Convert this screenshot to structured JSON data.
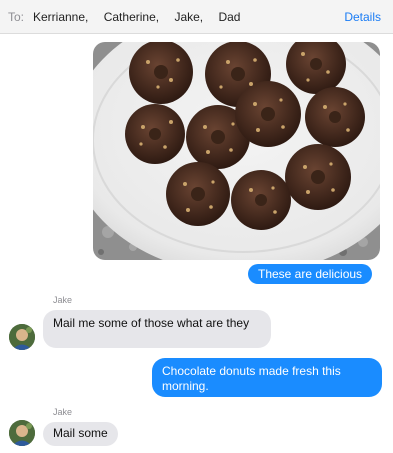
{
  "header": {
    "to_label": "To:",
    "recipients": [
      "Kerrianne,",
      "Catherine,",
      "Jake,",
      "Dad"
    ],
    "details_label": "Details"
  },
  "messages": [
    {
      "from": "me",
      "type": "image",
      "description": "photo-chocolate-donuts"
    },
    {
      "from": "me",
      "text": "These are delicious"
    },
    {
      "from": "Jake",
      "sender_label": "Jake",
      "text": "Mail me some of those what are they"
    },
    {
      "from": "me",
      "text": "Chocolate donuts made fresh this morning."
    },
    {
      "from": "Jake",
      "sender_label": "Jake",
      "text": "Mail some"
    }
  ],
  "colors": {
    "outgoing_bubble": "#1a8cff",
    "incoming_bubble": "#e6e6ea",
    "accent": "#1a7cf5"
  }
}
